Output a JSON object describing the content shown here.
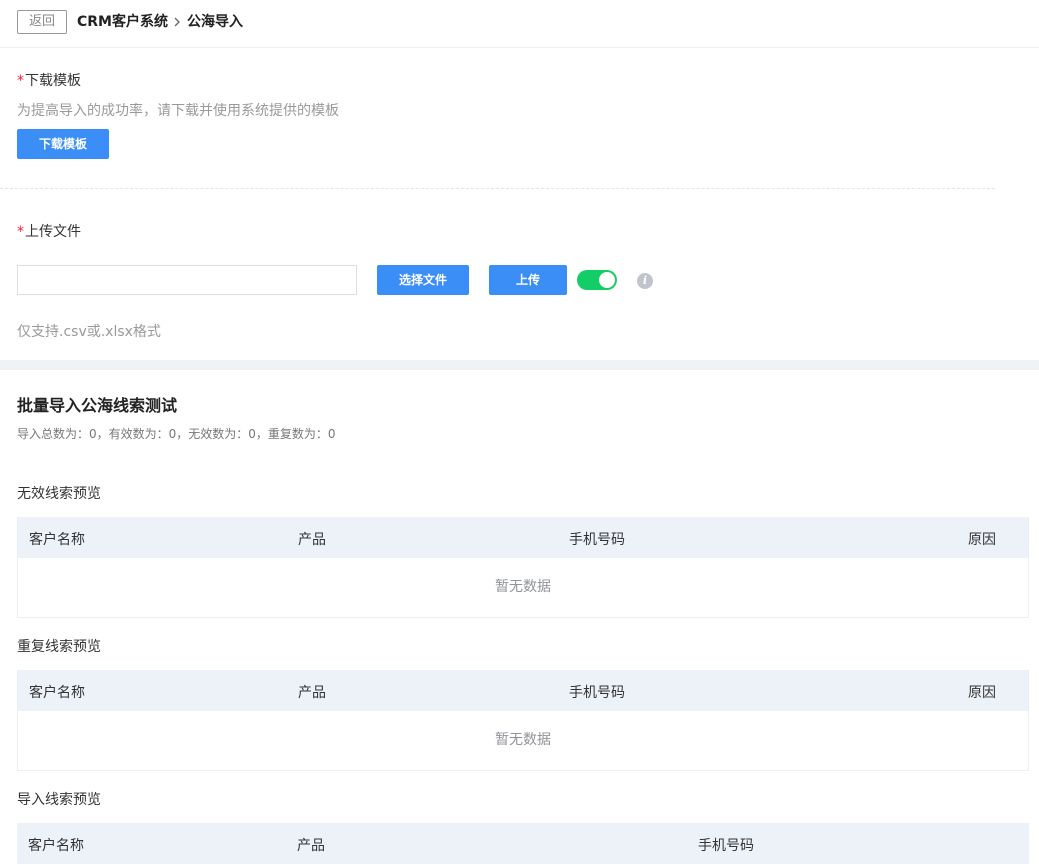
{
  "header": {
    "back_label": "返回",
    "breadcrumb": [
      "CRM客户系统",
      "公海导入"
    ]
  },
  "download": {
    "required_mark": "*",
    "title": "下载模板",
    "hint": "为提高导入的成功率，请下载并使用系统提供的模板",
    "button_label": "下载模板"
  },
  "upload": {
    "required_mark": "*",
    "title": "上传文件",
    "file_value": "",
    "choose_button": "选择文件",
    "upload_button": "上传",
    "toggle_on": true,
    "info_icon": "info-icon",
    "format_hint": "仅支持.csv或.xlsx格式"
  },
  "batch": {
    "title": "批量导入公海线索测试",
    "stats": "导入总数为：0，有效数为：0，无效数为：0，重复数为：0"
  },
  "invalid_preview": {
    "title": "无效线索预览",
    "columns": [
      "客户名称",
      "产品",
      "手机号码",
      "原因"
    ],
    "empty_text": "暂无数据"
  },
  "duplicate_preview": {
    "title": "重复线索预览",
    "columns": [
      "客户名称",
      "产品",
      "手机号码",
      "原因"
    ],
    "empty_text": "暂无数据"
  },
  "import_preview": {
    "title": "导入线索预览",
    "columns": [
      "客户名称",
      "产品",
      "手机号码"
    ]
  },
  "colors": {
    "primary": "#3a8ef6",
    "toggle_active": "#13ce66",
    "required": "#f5222d",
    "table_header_bg": "#edf1f8"
  }
}
